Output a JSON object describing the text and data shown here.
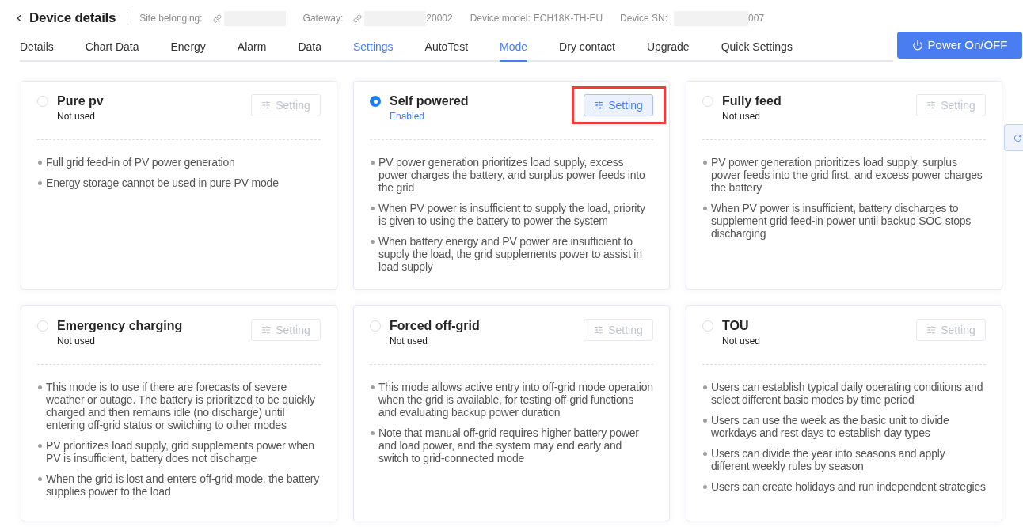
{
  "header": {
    "title": "Device details",
    "meta": [
      {
        "label": "Site belonging:",
        "link": true,
        "redacted": true
      },
      {
        "label": "Gateway:",
        "link": true,
        "redacted": true,
        "value": "20002"
      },
      {
        "label": "Device model:",
        "link": false,
        "redacted": false,
        "value": "ECH18K-TH-EU"
      },
      {
        "label": "Device SN:",
        "link": false,
        "redacted": true,
        "value": "007"
      }
    ]
  },
  "tabs": [
    {
      "label": "Details",
      "selected": false,
      "hovered": false
    },
    {
      "label": "Chart Data",
      "selected": false,
      "hovered": false
    },
    {
      "label": "Energy",
      "selected": false,
      "hovered": false
    },
    {
      "label": "Alarm",
      "selected": false,
      "hovered": false
    },
    {
      "label": "Data",
      "selected": false,
      "hovered": false
    },
    {
      "label": "Settings",
      "selected": false,
      "hovered": true
    },
    {
      "label": "AutoTest",
      "selected": false,
      "hovered": false
    },
    {
      "label": "Mode",
      "selected": true,
      "hovered": false
    },
    {
      "label": "Dry contact",
      "selected": false,
      "hovered": false
    },
    {
      "label": "Upgrade",
      "selected": false,
      "hovered": false
    },
    {
      "label": "Quick Settings",
      "selected": false,
      "hovered": false
    }
  ],
  "power_button": {
    "label": "Power On/OFF"
  },
  "modes": [
    {
      "title": "Pure pv",
      "status": "Not used",
      "selected": false,
      "annotated": false,
      "setting": {
        "label": "Setting",
        "disabled": true
      },
      "bullets": [
        "Full grid feed-in of PV power generation",
        "Energy storage cannot be used in pure PV mode"
      ]
    },
    {
      "title": "Self powered",
      "status": "Enabled",
      "selected": true,
      "annotated": true,
      "setting": {
        "label": "Setting",
        "disabled": false
      },
      "bullets": [
        "PV power generation prioritizes load supply, excess power charges the battery, and surplus power feeds into the grid",
        "When PV power is insufficient to supply the load, priority is given to using the battery to power the system",
        "When battery energy and PV power are insufficient to supply the load, the grid supplements power to assist in load supply"
      ]
    },
    {
      "title": "Fully feed",
      "status": "Not used",
      "selected": false,
      "annotated": false,
      "setting": {
        "label": "Setting",
        "disabled": true
      },
      "bullets": [
        "PV power generation prioritizes load supply, surplus power feeds into the grid first, and excess power charges the battery",
        "When PV power is insufficient, battery discharges to supplement grid feed-in power until backup SOC stops discharging"
      ]
    },
    {
      "title": "Emergency charging",
      "status": "Not used",
      "selected": false,
      "annotated": false,
      "setting": {
        "label": "Setting",
        "disabled": true
      },
      "bullets": [
        "This mode is to use if there are forecasts of severe weather or outage. The battery is prioritized to be quickly charged and then remains idle (no discharge) until entering off-grid status or switching to other modes",
        "PV prioritizes load supply, grid supplements power when PV is insufficient, battery does not discharge",
        "When the grid is lost and enters off-grid mode, the battery supplies power to the load"
      ]
    },
    {
      "title": "Forced off-grid",
      "status": "Not used",
      "selected": false,
      "annotated": false,
      "setting": {
        "label": "Setting",
        "disabled": true
      },
      "bullets": [
        "This mode allows active entry into off-grid mode operation when the grid is available, for testing off-grid functions and evaluating backup power duration",
        "Note that manual off-grid requires higher battery power and load power, and the system may end early and switch to grid-connected mode"
      ]
    },
    {
      "title": "TOU",
      "status": "Not used",
      "selected": false,
      "annotated": false,
      "setting": {
        "label": "Setting",
        "disabled": true
      },
      "bullets": [
        "Users can establish typical daily operating conditions and select different basic modes by time period",
        "Users can use the week as the basic unit to divide workdays and rest days to establish day types",
        "Users can divide the year into seasons and apply different weekly rules by season",
        "Users can create holidays and run independent strategies"
      ]
    }
  ]
}
